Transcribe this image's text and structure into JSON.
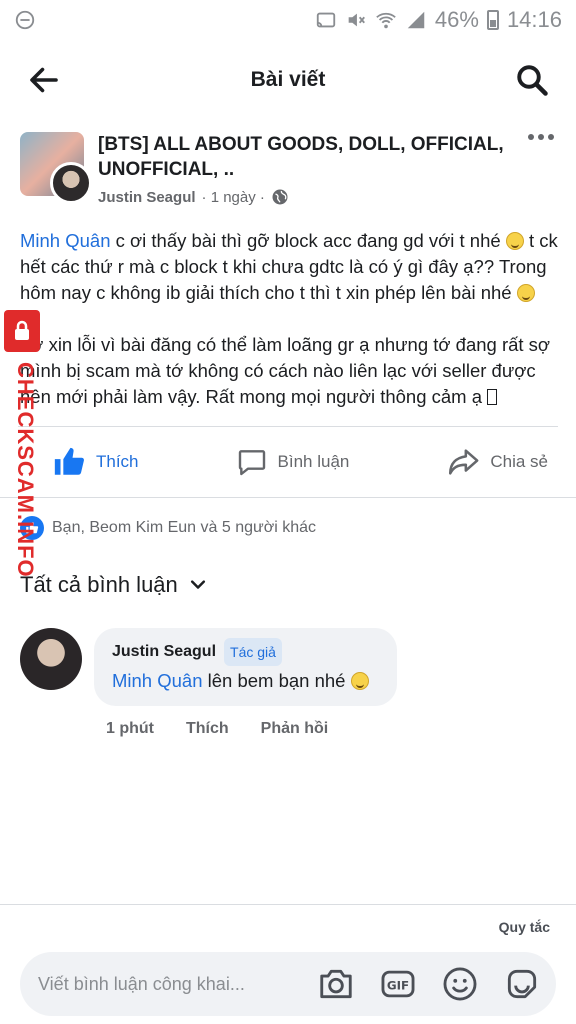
{
  "status_bar": {
    "battery": "46%",
    "time": "14:16"
  },
  "header": {
    "title": "Bài viết",
    "back_icon": "back-arrow-icon",
    "search_icon": "search-icon"
  },
  "post": {
    "group_name": "[BTS] ALL ABOUT GOODS, DOLL, OFFICIAL, UNOFFICIAL, ..",
    "author": "Justin Seagul",
    "time": "· 1 ngày ·",
    "privacy_icon": "globe-icon",
    "body": {
      "mention": "Minh Quân",
      "p1_text": "  c ơi thấy bài thì gỡ block acc đang gd với t nhé",
      "p1_text2": " t ck hết các thứ r mà c block t khi chưa gdtc là có ý gì đây ạ?? Trong hôm nay c không ib giải thích cho t thì t xin phép lên bài nhé",
      "p2_text": "Tớ xin lỗi vì bài đăng có thể làm loãng gr ạ nhưng tớ đang rất sợ mình bị scam mà tớ không có cách nào liên lạc với seller được nên mới phải làm vậy. Rất mong mọi người thông cảm ạ"
    }
  },
  "actions": {
    "like": "Thích",
    "comment": "Bình luận",
    "share": "Chia sẻ"
  },
  "reactions": {
    "text": "Bạn, Beom Kim Eun và 5 người khác"
  },
  "comments_section": {
    "title": "Tất cả bình luận",
    "items": [
      {
        "name": "Justin Seagul",
        "badge": "Tác giả",
        "mention": "Minh Quân",
        "text": " lên bem bạn nhé ",
        "time": "1 phút",
        "like": "Thích",
        "reply": "Phản hồi"
      }
    ]
  },
  "composer": {
    "rules": "Quy tắc",
    "placeholder": "Viết bình luận công khai...",
    "tools": [
      "camera-icon",
      "gif-icon",
      "emoji-icon",
      "sticker-icon"
    ]
  },
  "watermark": {
    "text": "CHECKSCAM.INFO"
  },
  "colors": {
    "accent": "#216fdb",
    "like_blue": "#1877f2",
    "watermark_red": "#e02b2b"
  }
}
